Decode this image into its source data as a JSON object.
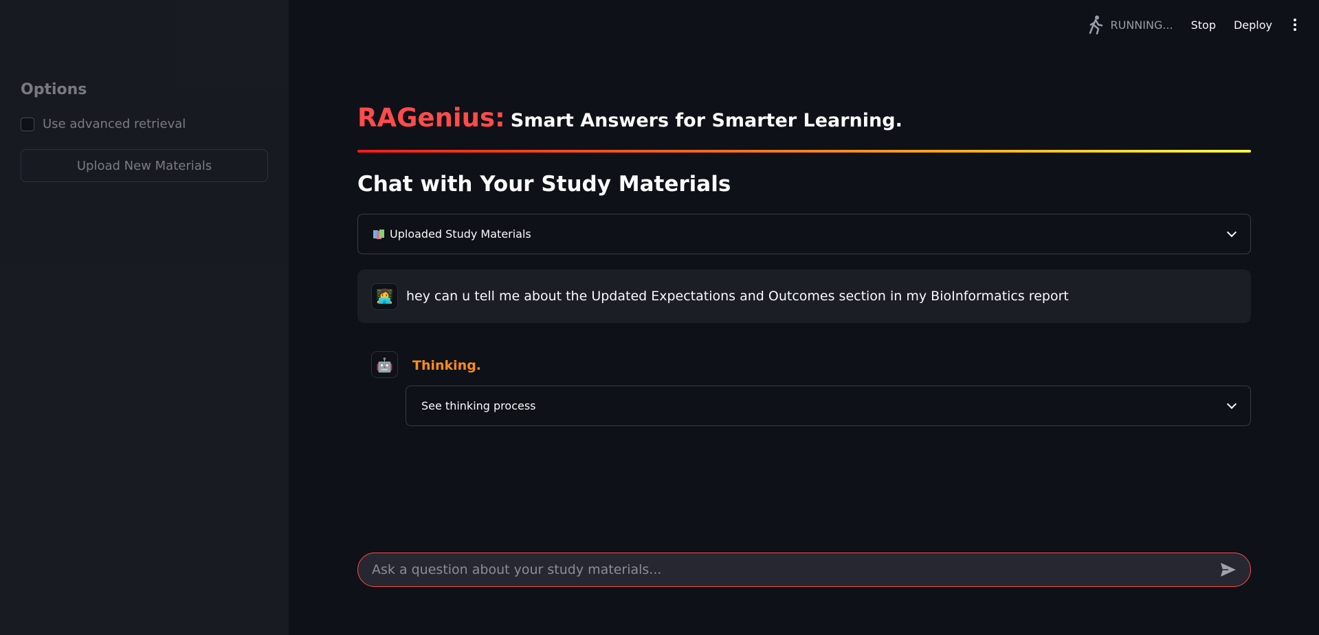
{
  "sidebar": {
    "title": "Options",
    "checkbox_label": "Use advanced retrieval",
    "upload_button": "Upload New Materials"
  },
  "toolbar": {
    "status": "RUNNING...",
    "stop": "Stop",
    "deploy": "Deploy"
  },
  "header": {
    "brand": "RAGenius:",
    "tagline": "Smart Answers for Smarter Learning."
  },
  "section_title": "Chat with Your Study Materials",
  "materials_expander": "Uploaded Study Materials",
  "messages": [
    {
      "role": "user",
      "avatar_icon": "👩‍💻",
      "text": "hey can u tell me about the Updated Expectations and Outcomes section in my BioInformatics report"
    }
  ],
  "assistant": {
    "avatar_icon": "🤖",
    "status": "Thinking.",
    "expander": "See thinking process"
  },
  "chat_input": {
    "placeholder": "Ask a question about your study materials..."
  },
  "colors": {
    "accent": "#ff4b4b",
    "thinking": "#ff8c1a",
    "background": "#0e1117",
    "sidebar": "#262730"
  }
}
